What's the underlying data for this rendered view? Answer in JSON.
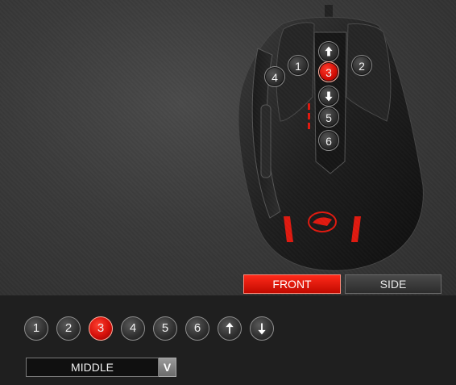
{
  "mouse_buttons": {
    "b1": "1",
    "b2": "2",
    "b3": "3",
    "b4": "4",
    "b5": "5",
    "b6": "6",
    "up": "up-arrow-icon",
    "down": "down-arrow-icon",
    "active": "3"
  },
  "views": {
    "front": "FRONT",
    "side": "SIDE",
    "active": "FRONT"
  },
  "selector": {
    "items": [
      "1",
      "2",
      "3",
      "4",
      "5",
      "6"
    ],
    "scroll_up": "up-arrow-icon",
    "scroll_down": "down-arrow-icon",
    "active": "3"
  },
  "assignment": {
    "value": "MIDDLE",
    "toggle": "V"
  },
  "colors": {
    "accent": "#d4100a",
    "background": "#2a2a2a",
    "panel": "#1f1f1f"
  }
}
